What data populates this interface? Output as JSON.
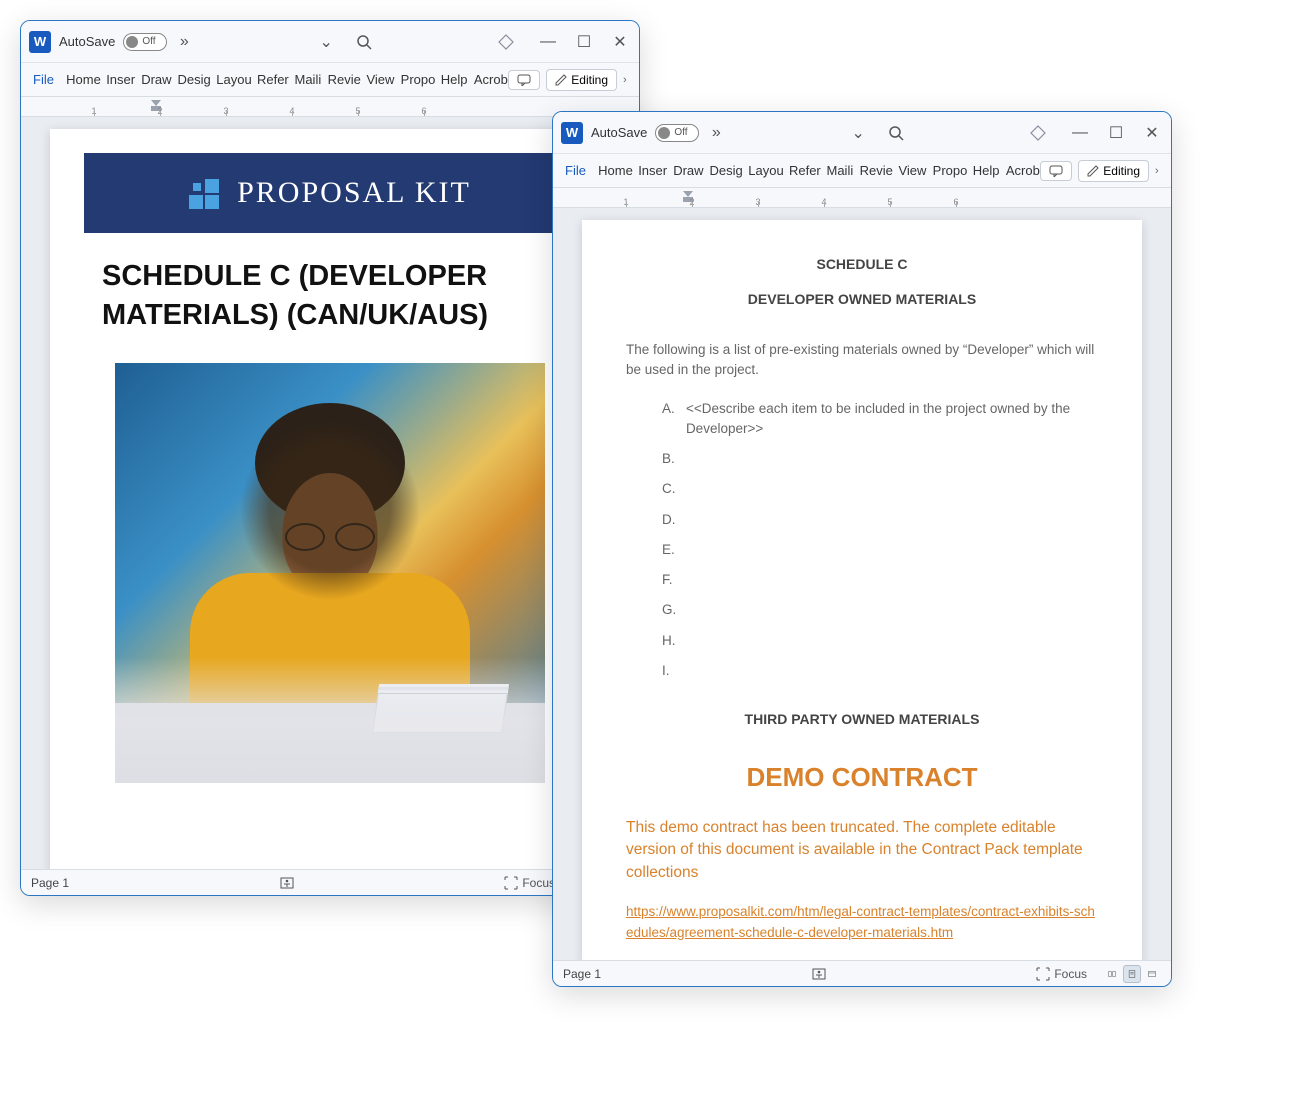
{
  "windows": {
    "w1": {
      "autosave_label": "AutoSave",
      "autosave_state": "Off",
      "page_status": "Page 1",
      "focus_label": "Focus"
    },
    "w2": {
      "autosave_label": "AutoSave",
      "autosave_state": "Off",
      "page_status": "Page 1",
      "focus_label": "Focus"
    }
  },
  "ribbon": {
    "file": "File",
    "tabs": [
      "Home",
      "Insert",
      "Draw",
      "Design",
      "Layout",
      "References",
      "Mailings",
      "Review",
      "View",
      "Proposal",
      "Help",
      "Acrobat"
    ],
    "tabs_abbrev": [
      "Home",
      "Inser",
      "Draw",
      "Desig",
      "Layou",
      "Refer",
      "Maili",
      "Revie",
      "View",
      "Propo",
      "Help",
      "Acrob"
    ],
    "tabs_abbrev2": [
      "Home",
      "Inser",
      "Draw",
      "Desig",
      "Layou",
      "Refer",
      "Maili",
      "Revie",
      "View",
      "Propo",
      "Help",
      "Acrob"
    ],
    "editing_label": "Editing"
  },
  "ruler_marks": [
    "1",
    "2",
    "3",
    "4",
    "5",
    "6"
  ],
  "doc1": {
    "brand": "Proposal Kit",
    "brand_upper": "PROPOSAL KIT",
    "title": "SCHEDULE C (DEVELOPER MATERIALS) (CAN/UK/AUS)"
  },
  "doc2": {
    "heading": "SCHEDULE C",
    "subheading": "DEVELOPER OWNED MATERIALS",
    "intro": "The following is a list of pre-existing materials owned by “Developer” which will be used in the project.",
    "items": [
      {
        "label": "A.",
        "text": "<<Describe each item to be included in the project owned by the Developer>>"
      },
      {
        "label": "B.",
        "text": ""
      },
      {
        "label": "C.",
        "text": ""
      },
      {
        "label": "D.",
        "text": ""
      },
      {
        "label": "E.",
        "text": ""
      },
      {
        "label": "F.",
        "text": ""
      },
      {
        "label": "G.",
        "text": ""
      },
      {
        "label": "H.",
        "text": ""
      },
      {
        "label": "I.",
        "text": ""
      }
    ],
    "third_party_heading": "THIRD PARTY OWNED MATERIALS",
    "demo_heading": "DEMO CONTRACT",
    "demo_text": "This demo contract has been truncated. The complete editable version of this document is available in the Contract Pack template collections",
    "demo_link": "https://www.proposalkit.com/htm/legal-contract-templates/contract-exhibits-schedules/agreement-schedule-c-developer-materials.htm"
  }
}
